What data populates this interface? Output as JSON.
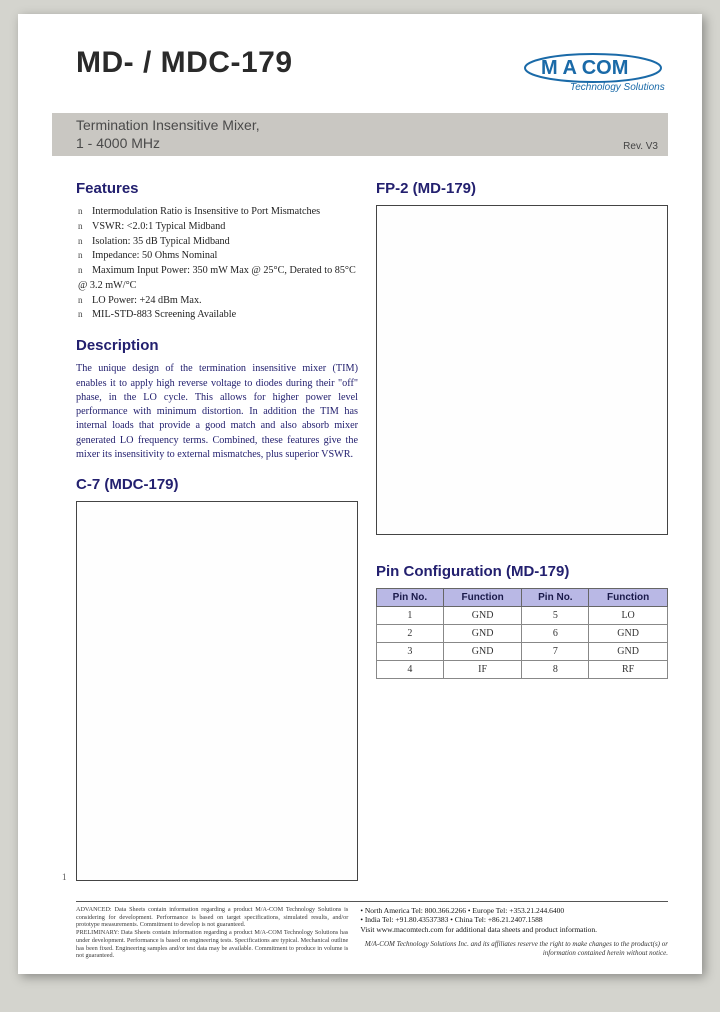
{
  "header": {
    "part_title": "MD- / MDC-179",
    "logo_brand": "M/A-COM",
    "logo_tagline": "Technology Solutions"
  },
  "subtitle": {
    "line1": "Termination Insensitive Mixer,",
    "line2": "1 - 4000 MHz",
    "rev": "Rev. V3"
  },
  "features": {
    "heading": "Features",
    "items": [
      "Intermodulation Ratio is Insensitive to Port Mismatches",
      "VSWR: <2.0:1 Typical Midband",
      "Isolation: 35 dB Typical Midband",
      "Impedance: 50 Ohms Nominal",
      "Maximum Input Power: 350 mW Max @ 25°C, Derated to 85°C @ 3.2 mW/°C",
      "LO Power: +24 dBm Max.",
      "MIL-STD-883 Screening Available"
    ]
  },
  "description": {
    "heading": "Description",
    "text": "The unique design of the termination insensitive mixer (TIM) enables it to apply high reverse voltage to diodes during their \"off\" phase, in the LO cycle.  This allows for higher power level performance with minimum distortion.  In addition the TIM has internal loads that provide a good match and also absorb mixer generated LO frequency terms.  Combined, these features give the mixer its insensitivity to external mismatches, plus superior VSWR."
  },
  "packages": {
    "fp2_heading": "FP-2 (MD-179)",
    "c7_heading": "C-7 (MDC-179)"
  },
  "pin_config": {
    "heading": "Pin Configuration (MD-179)",
    "headers": [
      "Pin No.",
      "Function",
      "Pin No.",
      "Function"
    ],
    "rows": [
      [
        "1",
        "GND",
        "5",
        "LO"
      ],
      [
        "2",
        "GND",
        "6",
        "GND"
      ],
      [
        "3",
        "GND",
        "7",
        "GND"
      ],
      [
        "4",
        "IF",
        "8",
        "RF"
      ]
    ]
  },
  "footer": {
    "page_no": "1",
    "advanced": "ADVANCED: Data Sheets contain information regarding a product M/A-COM Technology Solutions is considering for development. Performance is based on target specifications, simulated results, and/or prototype measurements. Commitment to develop is not guaranteed.",
    "preliminary": "PRELIMINARY: Data Sheets contain information regarding a product M/A-COM Technology Solutions has under development. Performance is based on engineering tests. Specifications are typical. Mechanical outline has been fixed. Engineering samples and/or test data may be available. Commitment to produce in volume is not guaranteed.",
    "contacts_line1": "• North America Tel: 800.366.2266   • Europe Tel: +353.21.244.6400",
    "contacts_line2": "• India Tel: +91.80.43537383   • China Tel: +86.21.2407.1588",
    "visit": "Visit www.macomtech.com for additional data sheets and product information.",
    "disclaimer": "M/A-COM Technology Solutions Inc. and its affiliates reserve the right to make changes to the product(s) or information contained herein without notice."
  }
}
